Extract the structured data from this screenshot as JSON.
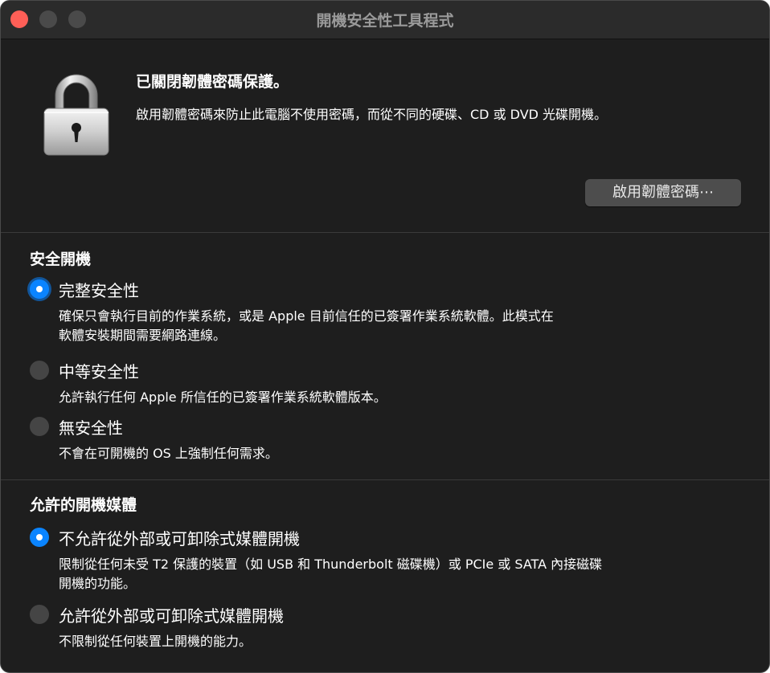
{
  "window": {
    "title": "開機安全性工具程式"
  },
  "firmware": {
    "status_title": "已關閉韌體密碼保護。",
    "description": "啟用韌體密碼來防止此電腦不使用密碼，而從不同的硬碟、CD 或 DVD 光碟開機。",
    "button_label": "啟用韌體密碼⋯"
  },
  "secure_boot": {
    "title": "安全開機",
    "options": [
      {
        "label": "完整安全性",
        "desc_line1": "確保只會執行目前的作業系統，或是 Apple 目前信任的已簽署作業系統軟體。此模式在",
        "desc_line2": "軟體安裝期間需要網路連線。",
        "selected": true
      },
      {
        "label": "中等安全性",
        "desc_line1": "允許執行任何 Apple 所信任的已簽署作業系統軟體版本。",
        "selected": false
      },
      {
        "label": "無安全性",
        "desc_line1": "不會在可開機的 OS 上強制任何需求。",
        "selected": false
      }
    ]
  },
  "boot_media": {
    "title": "允許的開機媒體",
    "options": [
      {
        "label": "不允許從外部或可卸除式媒體開機",
        "desc_line1": "限制從任何未受 T2 保護的裝置（如 USB 和 Thunderbolt 磁碟機）或 PCIe 或 SATA 內接磁碟",
        "desc_line2": "開機的功能。",
        "selected": true
      },
      {
        "label": "允許從外部或可卸除式媒體開機",
        "desc_line1": "不限制從任何裝置上開機的能力。",
        "selected": false
      }
    ]
  },
  "icons": {
    "lock": "lock-icon",
    "radio_on": "radio-selected-icon",
    "radio_off": "radio-unselected-icon"
  },
  "colors": {
    "accent": "#0a84ff",
    "close": "#ff5f57",
    "background": "#1e1e1e"
  }
}
